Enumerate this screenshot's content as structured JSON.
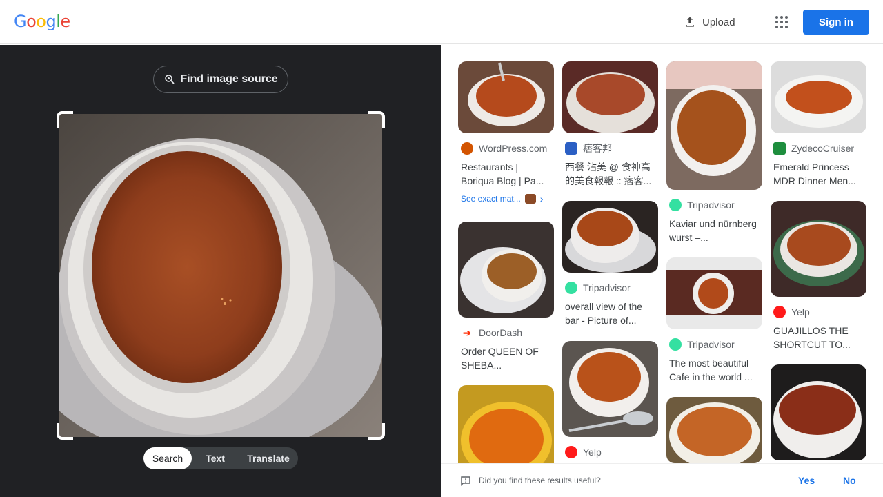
{
  "header": {
    "logo_letters": [
      {
        "ch": "G",
        "color": "#4285F4"
      },
      {
        "ch": "o",
        "color": "#EA4335"
      },
      {
        "ch": "o",
        "color": "#FBBC05"
      },
      {
        "ch": "g",
        "color": "#4285F4"
      },
      {
        "ch": "l",
        "color": "#34A853"
      },
      {
        "ch": "e",
        "color": "#EA4335"
      }
    ],
    "upload_label": "Upload",
    "signin_label": "Sign in"
  },
  "left": {
    "find_source_label": "Find image source",
    "modes": [
      "Search",
      "Text",
      "Translate"
    ],
    "active_mode": "Search"
  },
  "results": [
    {
      "source": "WordPress.com",
      "favicon": "wordpress-icon",
      "favicon_color": "#c0392b",
      "title": "Restaurants | Boriqua Blog | Pa...",
      "exact": "See exact mat..."
    },
    {
      "source": "痞客邦",
      "favicon": "pixnet-icon",
      "favicon_color": "#2b5fc4",
      "title": "西餐 沾美 @ 食神高的美食報報 :: 痞客..."
    },
    {
      "source": "Tripadvisor",
      "favicon": "tripadvisor-icon",
      "favicon_color": "#34e0a1",
      "title": "Kaviar und nürnberg wurst –..."
    },
    {
      "source": "ZydecoCruiser",
      "favicon": "zydeco-icon",
      "favicon_color": "#1e8e3e",
      "title": "Emerald Princess MDR Dinner Men..."
    },
    {
      "source": "DoorDash",
      "favicon": "doordash-icon",
      "favicon_color": "#ff3008",
      "title": "Order QUEEN OF SHEBA..."
    },
    {
      "source": "Tripadvisor",
      "favicon": "tripadvisor-icon",
      "favicon_color": "#34e0a1",
      "title": "overall view of the bar - Picture of..."
    },
    {
      "source": "Tripadvisor",
      "favicon": "tripadvisor-icon",
      "favicon_color": "#34e0a1",
      "title": "The most beautiful Cafe in the world ..."
    },
    {
      "source": "Yelp",
      "favicon": "yelp-icon",
      "favicon_color": "#ff1a1a",
      "title": "GUAJILLOS THE SHORTCUT TO..."
    },
    {
      "source": "Yelp",
      "favicon": "yelp-icon",
      "favicon_color": "#ff1a1a",
      "title": ""
    }
  ],
  "feedback": {
    "question": "Did you find these results useful?",
    "yes_label": "Yes",
    "no_label": "No"
  }
}
